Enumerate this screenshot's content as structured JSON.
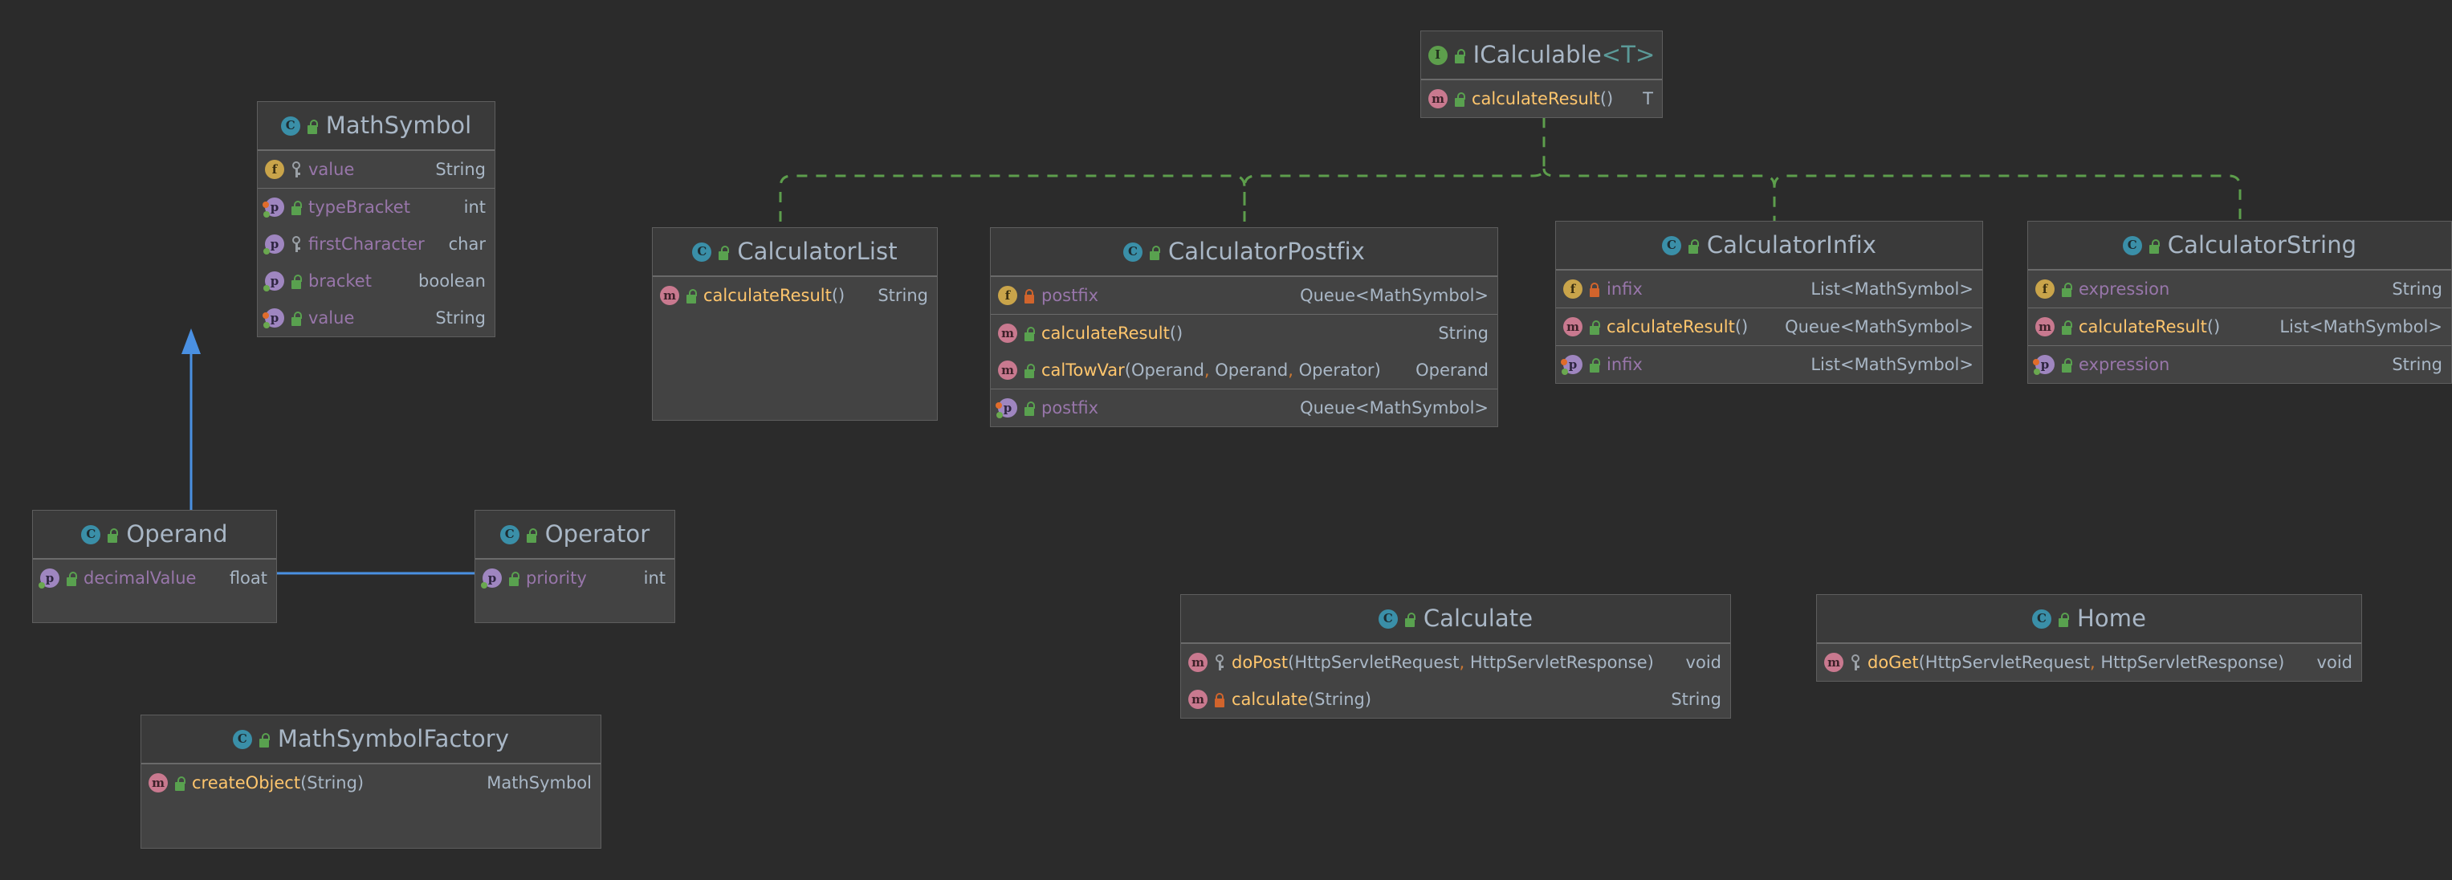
{
  "diagram": {
    "type": "uml-class-diagram",
    "background": "#2b2b2b",
    "inheritance_color": "#4a90e2",
    "realization_color": "#5d9e4c"
  },
  "nodes": {
    "icalculable": {
      "title": "ICalculable",
      "generic": "<T>",
      "kind": "interface",
      "visibility": "public",
      "sections": [
        {
          "rows": [
            {
              "kind": "method",
              "visibility": "public",
              "name": "calculateResult",
              "params": "()",
              "type": "T",
              "type_style": "generic"
            }
          ]
        }
      ]
    },
    "mathsymbol": {
      "title": "MathSymbol",
      "generic": "",
      "kind": "class",
      "visibility": "public",
      "sections": [
        {
          "rows": [
            {
              "kind": "field",
              "visibility": "protected",
              "name": "value",
              "params": "",
              "type": "String",
              "type_style": "ref"
            }
          ]
        },
        {
          "rows": [
            {
              "kind": "property",
              "accessors": "both",
              "visibility": "public",
              "name": "typeBracket",
              "params": "",
              "type": "int",
              "type_style": "primitive"
            },
            {
              "kind": "property",
              "accessors": "get",
              "visibility": "protected",
              "name": "firstCharacter",
              "params": "",
              "type": "char",
              "type_style": "primitive"
            },
            {
              "kind": "property",
              "accessors": "get",
              "visibility": "public",
              "name": "bracket",
              "params": "",
              "type": "boolean",
              "type_style": "primitive"
            },
            {
              "kind": "property",
              "accessors": "both",
              "visibility": "public",
              "name": "value",
              "params": "",
              "type": "String",
              "type_style": "ref"
            }
          ]
        }
      ]
    },
    "calculatorlist": {
      "title": "CalculatorList",
      "generic": "",
      "kind": "class",
      "visibility": "public",
      "sections": [
        {
          "rows": [
            {
              "kind": "method",
              "visibility": "public",
              "name": "calculateResult",
              "params": "()",
              "type": "String",
              "type_style": "ref"
            }
          ]
        }
      ]
    },
    "calculatorpostfix": {
      "title": "CalculatorPostfix",
      "generic": "",
      "kind": "class",
      "visibility": "public",
      "sections": [
        {
          "rows": [
            {
              "kind": "field",
              "visibility": "private",
              "name": "postfix",
              "params": "",
              "type": "Queue<MathSymbol>",
              "type_style": "ref"
            }
          ]
        },
        {
          "rows": [
            {
              "kind": "method",
              "visibility": "public",
              "name": "calculateResult",
              "params": "()",
              "type": "String",
              "type_style": "ref"
            },
            {
              "kind": "method",
              "visibility": "public",
              "name": "calTowVar",
              "params": "(Operand, Operand, Operator)",
              "type": "Operand",
              "type_style": "ref"
            }
          ]
        },
        {
          "rows": [
            {
              "kind": "property",
              "accessors": "both",
              "visibility": "public",
              "name": "postfix",
              "params": "",
              "type": "Queue<MathSymbol>",
              "type_style": "ref"
            }
          ]
        }
      ]
    },
    "calculatorinfix": {
      "title": "CalculatorInfix",
      "generic": "",
      "kind": "class",
      "visibility": "public",
      "sections": [
        {
          "rows": [
            {
              "kind": "field",
              "visibility": "private",
              "name": "infix",
              "params": "",
              "type": "List<MathSymbol>",
              "type_style": "ref"
            }
          ]
        },
        {
          "rows": [
            {
              "kind": "method",
              "visibility": "public",
              "name": "calculateResult",
              "params": "()",
              "type": "Queue<MathSymbol>",
              "type_style": "ref"
            }
          ]
        },
        {
          "rows": [
            {
              "kind": "property",
              "accessors": "both",
              "visibility": "public",
              "name": "infix",
              "params": "",
              "type": "List<MathSymbol>",
              "type_style": "ref"
            }
          ]
        }
      ]
    },
    "calculatorstring": {
      "title": "CalculatorString",
      "generic": "",
      "kind": "class",
      "visibility": "public",
      "sections": [
        {
          "rows": [
            {
              "kind": "field",
              "visibility": "public",
              "name": "expression",
              "params": "",
              "type": "String",
              "type_style": "ref"
            }
          ]
        },
        {
          "rows": [
            {
              "kind": "method",
              "visibility": "public",
              "name": "calculateResult",
              "params": "()",
              "type": "List<MathSymbol>",
              "type_style": "ref"
            }
          ]
        },
        {
          "rows": [
            {
              "kind": "property",
              "accessors": "both",
              "visibility": "public",
              "name": "expression",
              "params": "",
              "type": "String",
              "type_style": "ref"
            }
          ]
        }
      ]
    },
    "operand": {
      "title": "Operand",
      "generic": "",
      "kind": "class",
      "visibility": "public",
      "sections": [
        {
          "rows": [
            {
              "kind": "property",
              "accessors": "get",
              "visibility": "public",
              "name": "decimalValue",
              "params": "",
              "type": "float",
              "type_style": "primitive"
            }
          ]
        }
      ]
    },
    "operator": {
      "title": "Operator",
      "generic": "",
      "kind": "class",
      "visibility": "public",
      "sections": [
        {
          "rows": [
            {
              "kind": "property",
              "accessors": "get",
              "visibility": "public",
              "name": "priority",
              "params": "",
              "type": "int",
              "type_style": "primitive"
            }
          ]
        }
      ]
    },
    "mathsymbolfactory": {
      "title": "MathSymbolFactory",
      "generic": "",
      "kind": "class",
      "visibility": "public",
      "sections": [
        {
          "rows": [
            {
              "kind": "method",
              "visibility": "public",
              "name": "createObject",
              "params": "(String)",
              "type": "MathSymbol",
              "type_style": "ref"
            }
          ]
        }
      ]
    },
    "calculate": {
      "title": "Calculate",
      "generic": "",
      "kind": "class",
      "visibility": "public",
      "sections": [
        {
          "rows": [
            {
              "kind": "method",
              "visibility": "protected",
              "name": "doPost",
              "params": "(HttpServletRequest, HttpServletResponse)",
              "type": "void",
              "type_style": "primitive"
            },
            {
              "kind": "method",
              "visibility": "private",
              "name": "calculate",
              "params": "(String)",
              "type": "String",
              "type_style": "ref"
            }
          ]
        }
      ]
    },
    "home": {
      "title": "Home",
      "generic": "",
      "kind": "class",
      "visibility": "public",
      "sections": [
        {
          "rows": [
            {
              "kind": "method",
              "visibility": "protected",
              "name": "doGet",
              "params": "(HttpServletRequest, HttpServletResponse)",
              "type": "void",
              "type_style": "primitive"
            }
          ]
        }
      ]
    }
  },
  "relations": [
    {
      "from": "operand",
      "to": "mathsymbol",
      "kind": "generalization",
      "style": "solid",
      "color": "#4a90e2"
    },
    {
      "from": "operator",
      "to": "mathsymbol",
      "kind": "generalization",
      "style": "solid",
      "color": "#4a90e2"
    },
    {
      "from": "calculatorlist",
      "to": "icalculable",
      "kind": "realization",
      "style": "dashed",
      "color": "#5d9e4c"
    },
    {
      "from": "calculatorpostfix",
      "to": "icalculable",
      "kind": "realization",
      "style": "dashed",
      "color": "#5d9e4c"
    },
    {
      "from": "calculatorinfix",
      "to": "icalculable",
      "kind": "realization",
      "style": "dashed",
      "color": "#5d9e4c"
    },
    {
      "from": "calculatorstring",
      "to": "icalculable",
      "kind": "realization",
      "style": "dashed",
      "color": "#5d9e4c"
    }
  ]
}
